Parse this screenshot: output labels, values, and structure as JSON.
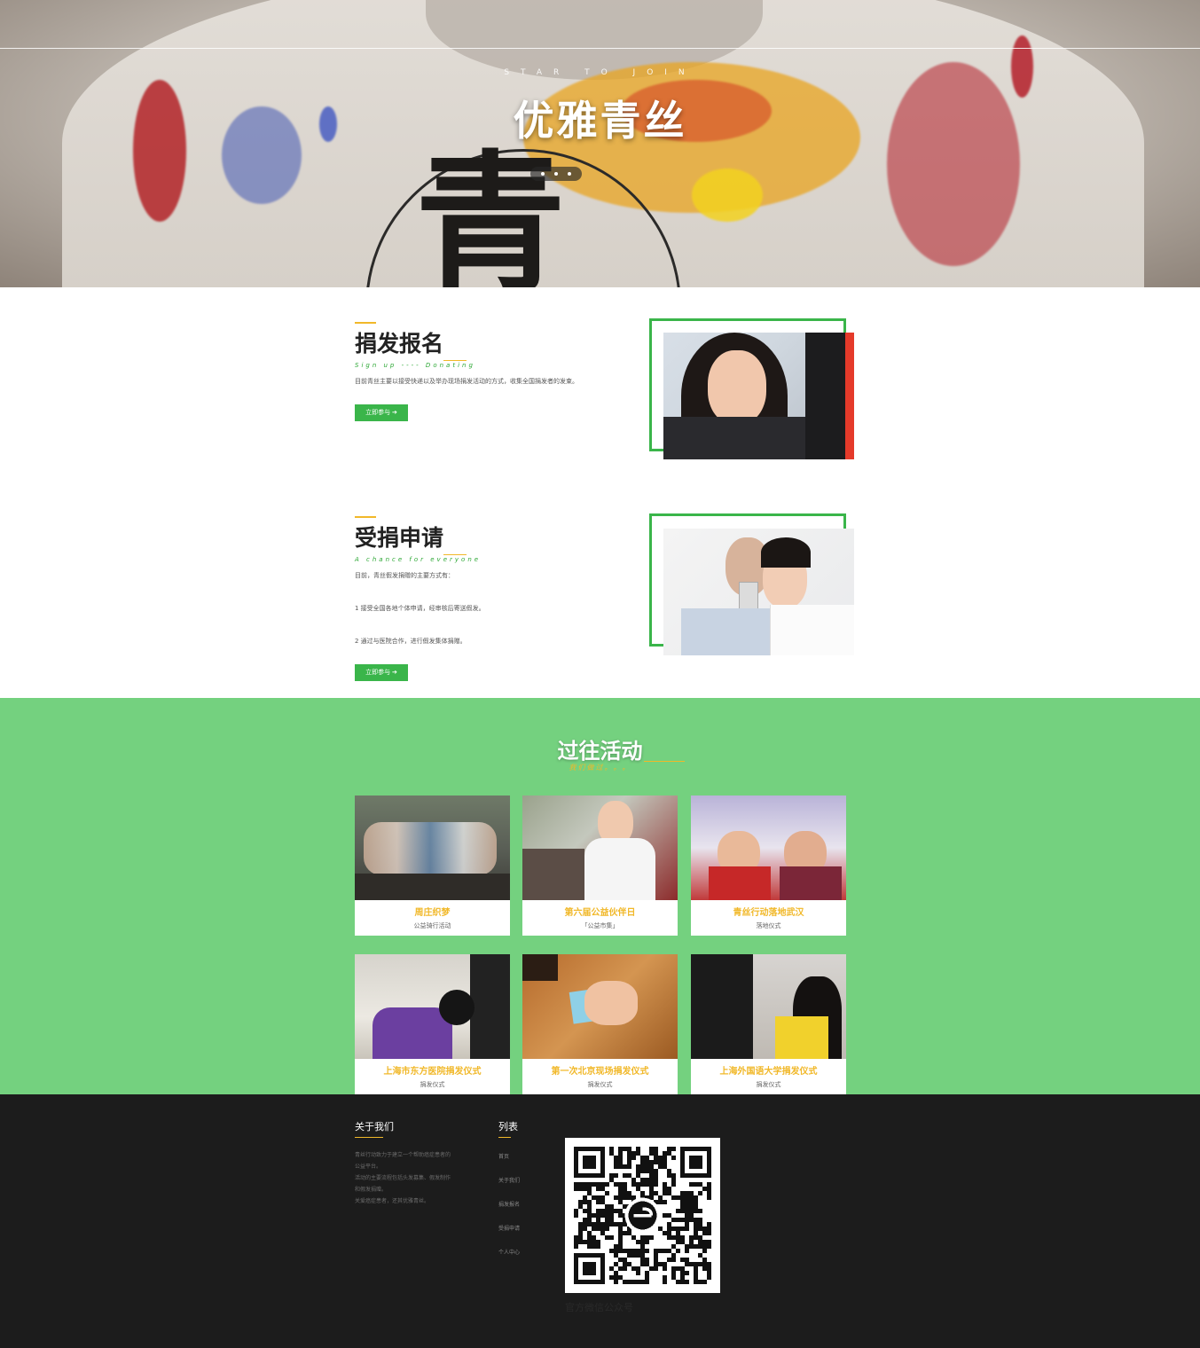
{
  "hero": {
    "kicker": "STAR TO JOIN",
    "title": "优雅青丝",
    "shirt_glyph": "青",
    "slides": 3
  },
  "donate": {
    "title": "捐发报名",
    "subtitle": "Sign up ---- Donating",
    "desc": "目前青丝主要以接受快递以及举办现场捐发活动的方式，收集全国捐发者的发束。",
    "button": "立即参与 ➔"
  },
  "receive": {
    "title": "受捐申请",
    "subtitle": "A chance for everyone",
    "lines": [
      "目前，青丝假发捐赠的主要方式有：",
      "1 接受全国各地个体申请，经审核后寄送假发。",
      "2 通过与医院合作，进行假发集体捐赠。"
    ],
    "button": "立即参与 ➔"
  },
  "past": {
    "title": "过往活动",
    "subtitle": "我们做过。。。",
    "events": [
      {
        "title": "周庄织梦",
        "sub": "公益骑行活动"
      },
      {
        "title": "第六届公益伙伴日",
        "sub": "「公益市集」"
      },
      {
        "title": "青丝行动落地武汉",
        "sub": "落地仪式"
      },
      {
        "title": "上海市东方医院捐发仪式",
        "sub": "捐发仪式"
      },
      {
        "title": "第一次北京现场捐发仪式",
        "sub": "捐发仪式"
      },
      {
        "title": "上海外国语大学捐发仪式",
        "sub": "捐发仪式"
      }
    ]
  },
  "footer": {
    "about_title": "关于我们",
    "about_lines": [
      "青丝行动致力于建立一个帮助癌症患者的",
      "公益平台。",
      "活动的主要流程包括头发募集、假发制作",
      "和假发捐赠。",
      "关爱癌症患者，还其优雅青丝。"
    ],
    "menu_title": "列表",
    "menu": [
      "首页",
      "关于我们",
      "捐发报名",
      "受捐申请",
      "个人中心"
    ],
    "qr_caption": "官方微信公众号"
  },
  "colors": {
    "accent_green": "#3ab54a",
    "section_green": "#74d17f",
    "accent_yellow": "#f1b829",
    "footer_bg": "#1c1c1c"
  }
}
